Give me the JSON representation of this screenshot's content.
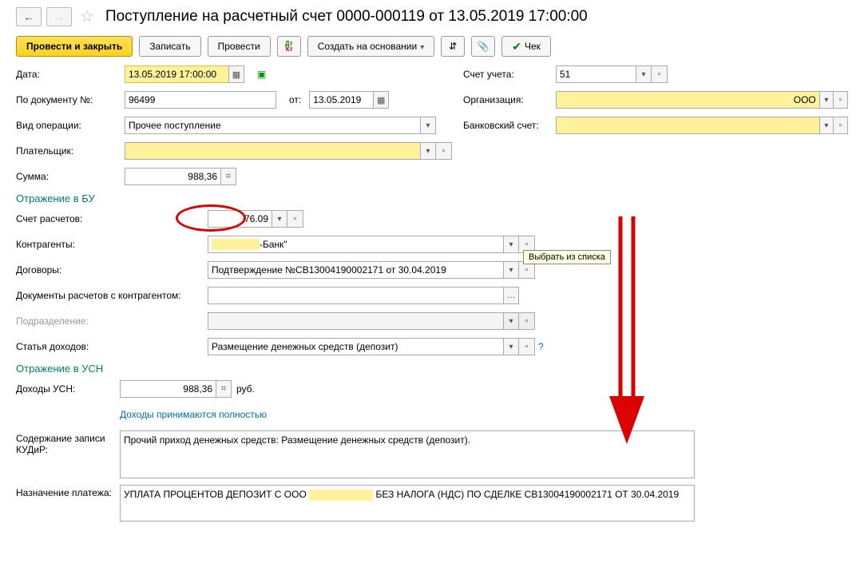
{
  "header": {
    "title": "Поступление на расчетный счет 0000-000119 от 13.05.2019 17:00:00"
  },
  "toolbar": {
    "post_close": "Провести и закрыть",
    "write": "Записать",
    "post": "Провести",
    "create_based": "Создать на основании",
    "check": "Чек"
  },
  "labels": {
    "date": "Дата:",
    "by_doc": "По документу №:",
    "from": "от:",
    "op_type": "Вид операции:",
    "payer": "Плательщик:",
    "amount": "Сумма:",
    "account_uchet": "Счет учета:",
    "org": "Организация:",
    "bank_account": "Банковский счет:",
    "section_bu": "Отражение в БУ",
    "calc_account": "Счет расчетов:",
    "counterparties": "Контрагенты:",
    "contracts": "Договоры:",
    "calc_docs": "Документы расчетов с контрагентом:",
    "subdivision": "Подразделение:",
    "income_article": "Статья доходов:",
    "section_usn": "Отражение в УСН",
    "income_usn": "Доходы УСН:",
    "rub": "руб.",
    "income_full": "Доходы принимаются полностью",
    "kudir_content": "Содержание записи КУДиР:",
    "payment_purpose": "Назначение платежа:"
  },
  "values": {
    "date": "13.05.2019 17:00:00",
    "doc_num": "96499",
    "doc_date": "13.05.2019",
    "op_type": "Прочее поступление",
    "amount": "988,36",
    "account_uchet": "51",
    "org_suffix": "ООО",
    "calc_account": "76.09",
    "counterparty_suffix": "-Банк\"",
    "contract": "Подтверждение №СВ13004190002171 от 30.04.2019",
    "income_article": "Размещение денежных средств (депозит)",
    "income_usn": "988,36",
    "kudir_content": "Прочий приход денежных средств: Размещение денежных средств (депозит).",
    "payment_purpose_prefix": "УПЛАТА ПРОЦЕНТОВ ДЕПОЗИТ С ООО ",
    "payment_purpose_suffix": " БЕЗ НАЛОГА (НДС) ПО СДЕЛКЕ СВ13004190002171 ОТ 30.04.2019"
  },
  "tooltip": "Выбрать из списка"
}
